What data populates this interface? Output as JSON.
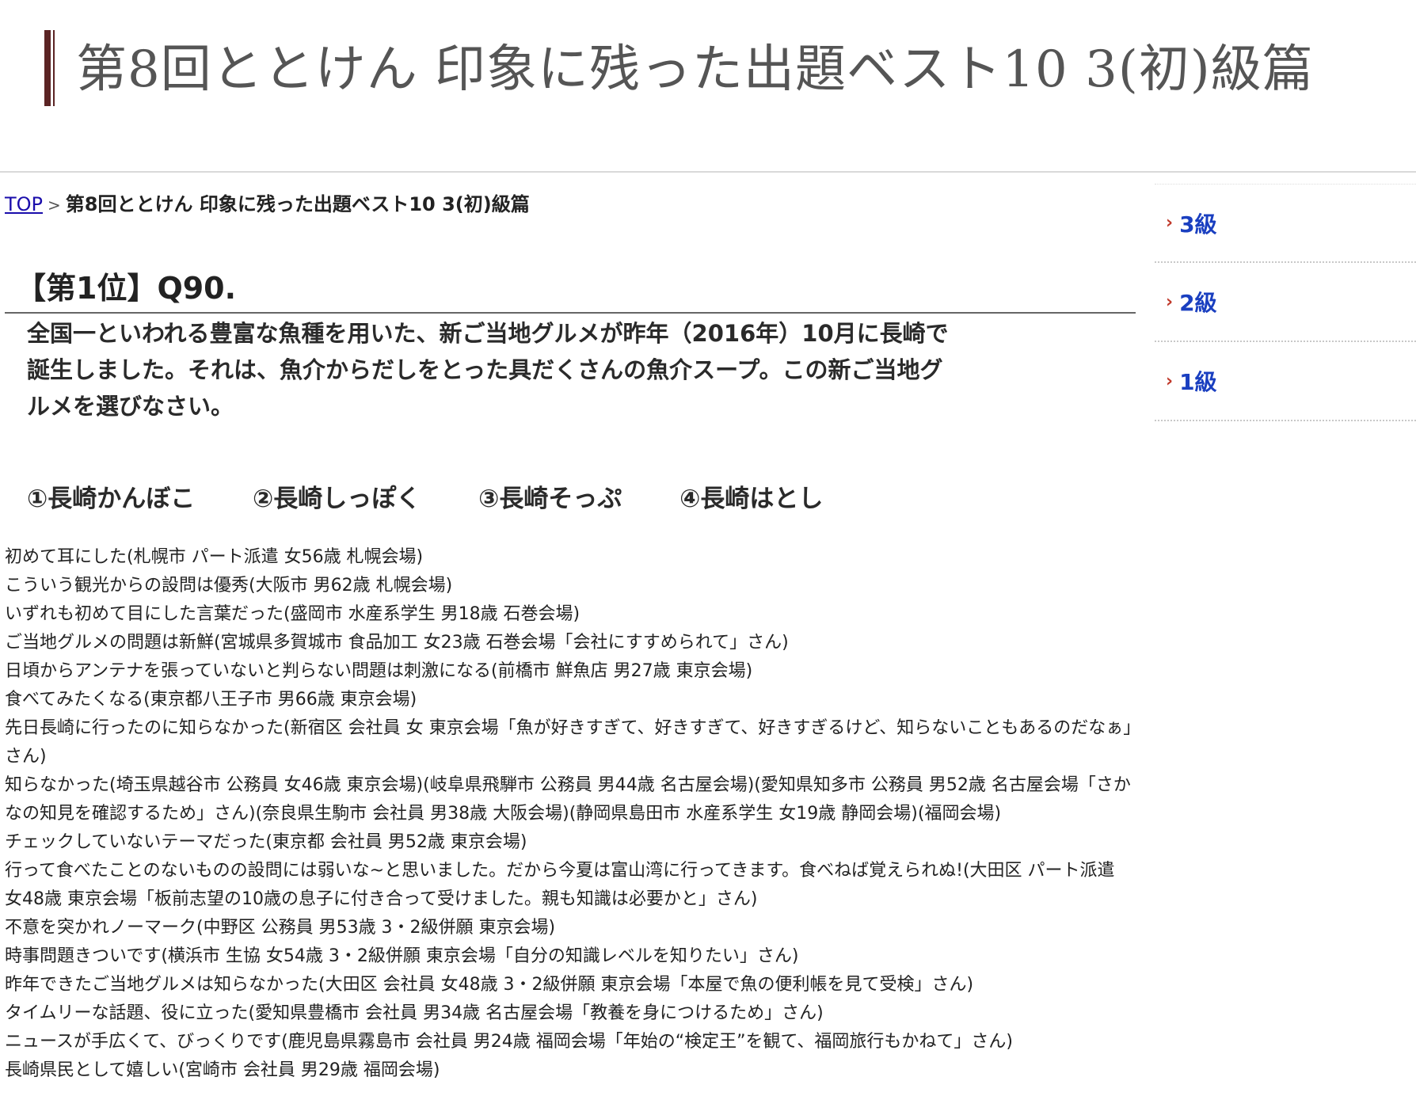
{
  "header": {
    "title": "第8回ととけん 印象に残った出題ベスト10 3(初)級篇"
  },
  "breadcrumb": {
    "top_link": "TOP",
    "separator": ">",
    "current": "第8回ととけん 印象に残った出題ベスト10 3(初)級篇"
  },
  "question": {
    "heading": "【第1位】Q90.",
    "text": "全国一といわれる豊富な魚種を用いた、新ご当地グルメが昨年（2016年）10月に長崎で誕生しました。それは、魚介からだしをとった具だくさんの魚介スープ。この新ご当地グルメを選びなさい。",
    "options": [
      "①長崎かんぼこ",
      "②長崎しっぽく",
      "③長崎そっぷ",
      "④長崎はとし"
    ]
  },
  "comments": [
    "初めて耳にした(札幌市 パート派遣 女56歳 札幌会場)",
    "こういう観光からの設問は優秀(大阪市 男62歳 札幌会場)",
    "いずれも初めて目にした言葉だった(盛岡市 水産系学生 男18歳 石巻会場)",
    "ご当地グルメの問題は新鮮(宮城県多賀城市 食品加工 女23歳 石巻会場「会社にすすめられて」さん)",
    "日頃からアンテナを張っていないと判らない問題は刺激になる(前橋市 鮮魚店 男27歳 東京会場)",
    "食べてみたくなる(東京都八王子市 男66歳 東京会場)",
    "先日長崎に行ったのに知らなかった(新宿区 会社員 女 東京会場「魚が好きすぎて、好きすぎて、好きすぎるけど、知らないこともあるのだなぁ」さん)",
    "知らなかった(埼玉県越谷市 公務員 女46歳 東京会場)(岐阜県飛騨市 公務員 男44歳 名古屋会場)(愛知県知多市 公務員 男52歳 名古屋会場「さかなの知見を確認するため」さん)(奈良県生駒市 会社員 男38歳 大阪会場)(静岡県島田市 水産系学生 女19歳 静岡会場)(福岡会場)",
    "チェックしていないテーマだった(東京都 会社員 男52歳 東京会場)",
    "行って食べたことのないものの設問には弱いな~と思いました。だから今夏は富山湾に行ってきます。食べねば覚えられぬ!(大田区 パート派遣 女48歳 東京会場「板前志望の10歳の息子に付き合って受けました。親も知識は必要かと」さん)",
    "不意を突かれノーマーク(中野区 公務員 男53歳 3・2級併願 東京会場)",
    "時事問題きついです(横浜市 生協 女54歳 3・2級併願 東京会場「自分の知識レベルを知りたい」さん)",
    "昨年できたご当地グルメは知らなかった(大田区 会社員 女48歳 3・2級併願 東京会場「本屋で魚の便利帳を見て受検」さん)",
    "タイムリーな話題、役に立った(愛知県豊橋市 会社員 男34歳 名古屋会場「教養を身につけるため」さん)",
    "ニュースが手広くて、びっくりです(鹿児島県霧島市 会社員 男24歳 福岡会場「年始の“検定王”を観て、福岡旅行もかねて」さん)",
    "長崎県民として嬉しい(宮崎市 会社員 男29歳 福岡会場)"
  ],
  "sidebar": {
    "items": [
      {
        "label": "3級",
        "icon": "chevron-right-icon"
      },
      {
        "label": "2級",
        "icon": "chevron-right-icon"
      },
      {
        "label": "1級",
        "icon": "chevron-right-icon"
      }
    ]
  },
  "colors": {
    "title_bar": "#5b2424",
    "link": "#1a0dab",
    "sidebar_link": "#1a3fc0",
    "arrow": "#c0392b"
  }
}
